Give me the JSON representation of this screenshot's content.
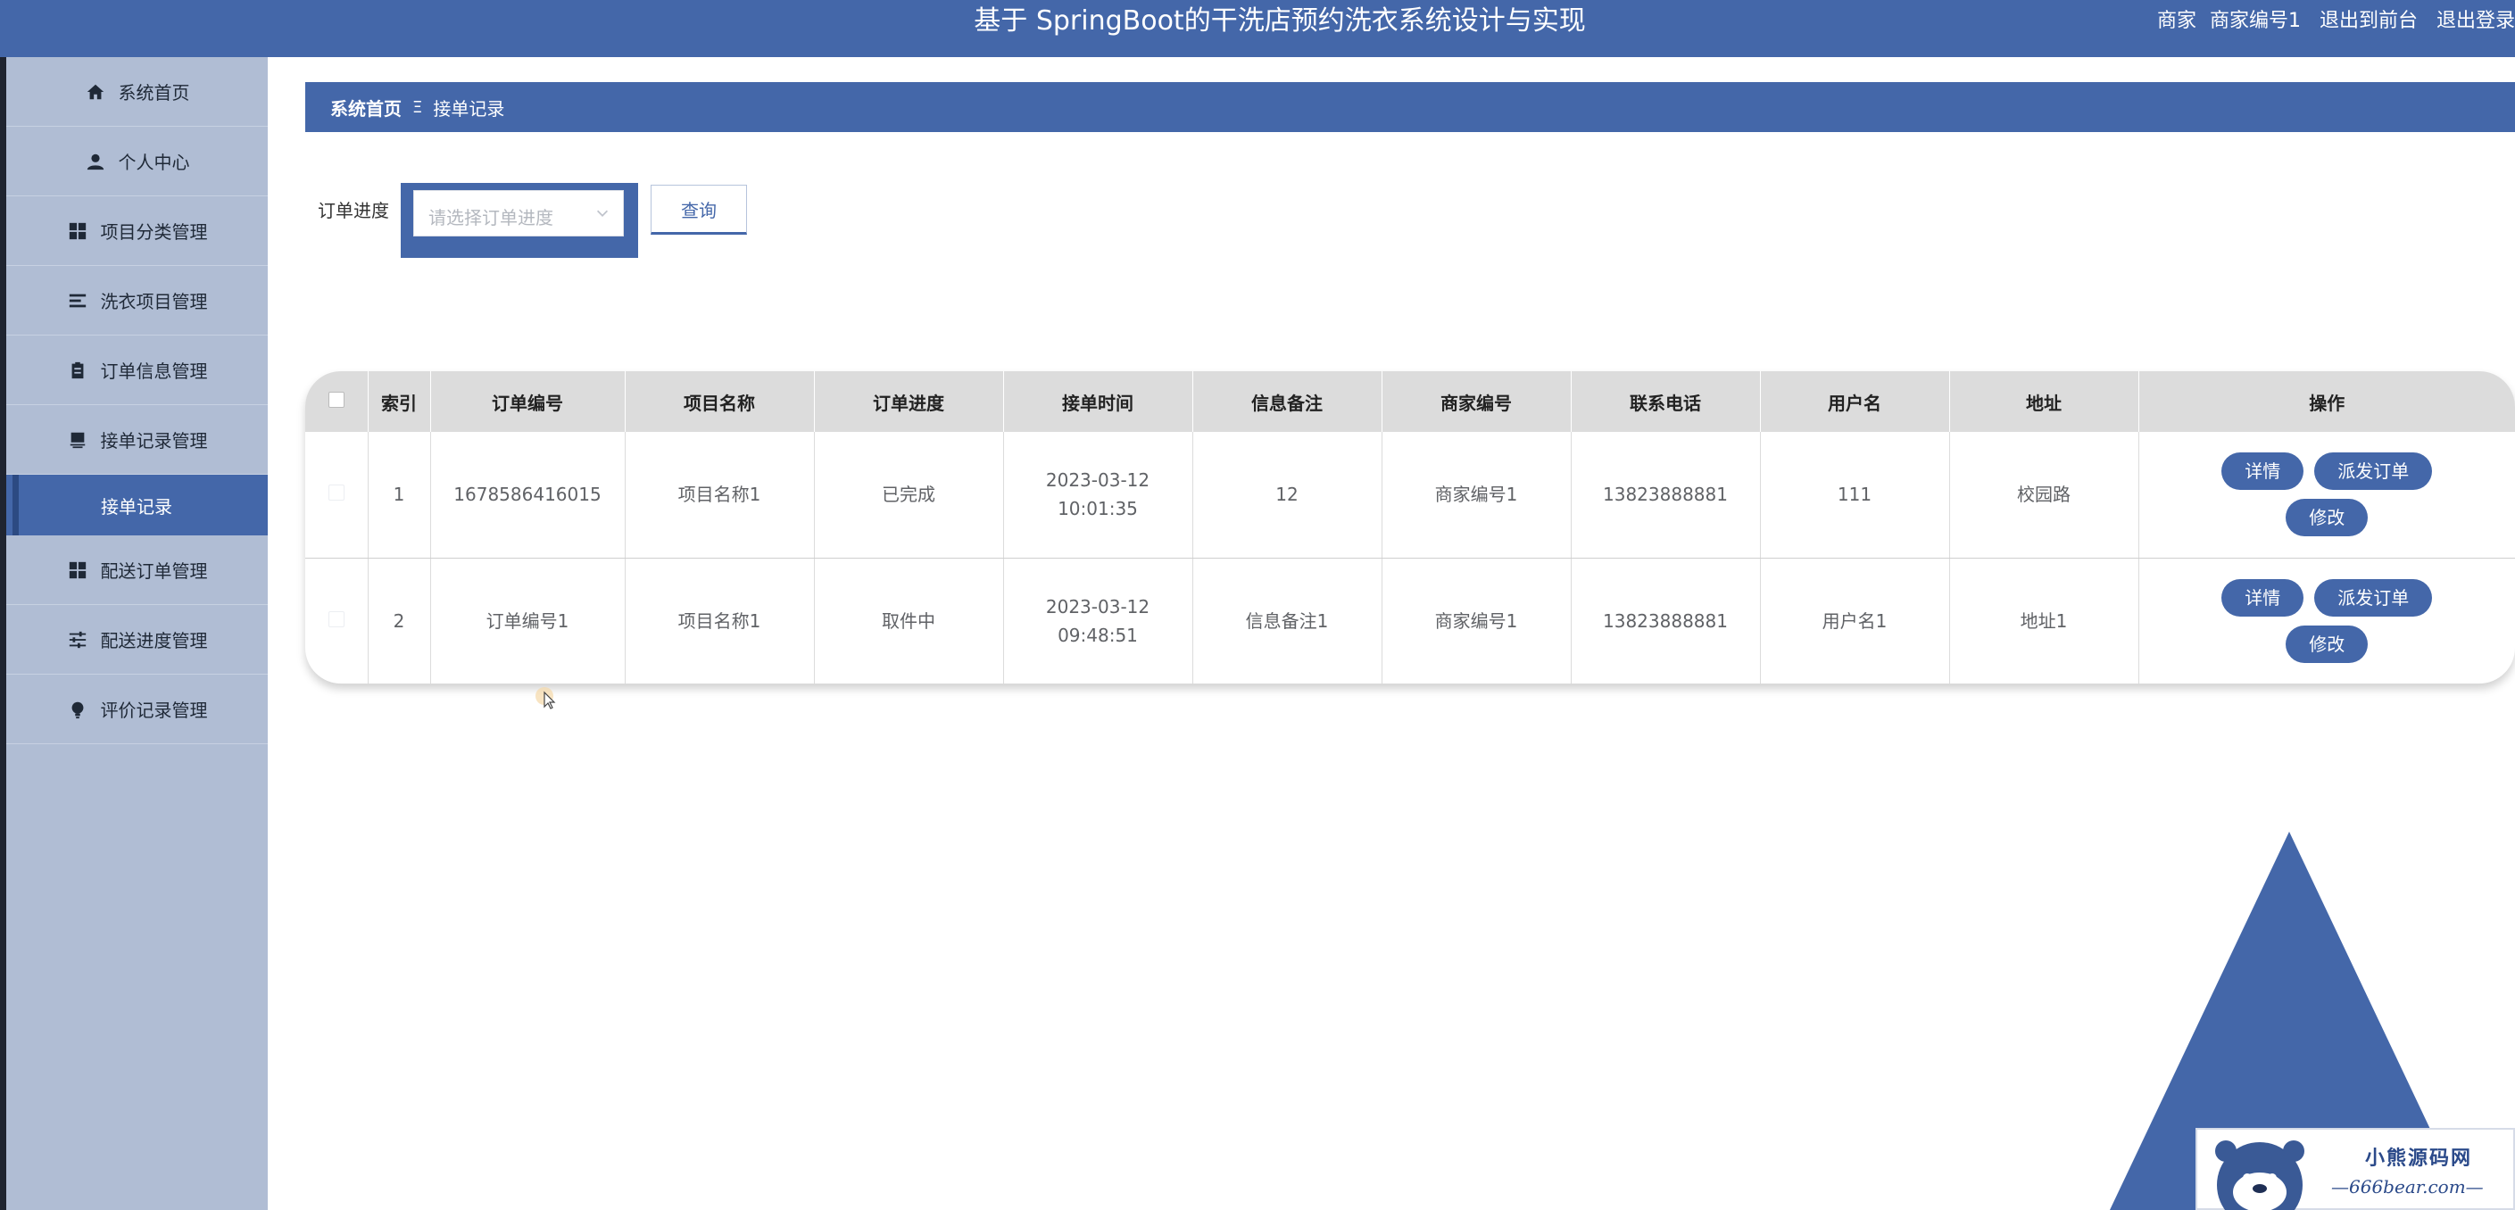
{
  "header": {
    "title": "基于 SpringBoot的干洗店预约洗衣系统设计与实现",
    "role": "商家",
    "username": "商家编号1",
    "to_front": "退出到前台",
    "logout": "退出登录"
  },
  "sidebar": {
    "items": [
      {
        "label": "系统首页",
        "icon": "home-icon"
      },
      {
        "label": "个人中心",
        "icon": "user-icon"
      },
      {
        "label": "项目分类管理",
        "icon": "grid-icon"
      },
      {
        "label": "洗衣项目管理",
        "icon": "list-icon"
      },
      {
        "label": "订单信息管理",
        "icon": "clipboard-icon"
      },
      {
        "label": "接单记录管理",
        "icon": "stamp-icon"
      }
    ],
    "active_sub": "接单记录",
    "items_after": [
      {
        "label": "配送订单管理",
        "icon": "grid-icon"
      },
      {
        "label": "配送进度管理",
        "icon": "sliders-icon"
      },
      {
        "label": "评价记录管理",
        "icon": "bulb-icon"
      }
    ]
  },
  "breadcrumb": {
    "home": "系统首页",
    "separator": "Ξ",
    "current": "接单记录"
  },
  "search": {
    "label": "订单进度",
    "placeholder": "请选择订单进度",
    "query_button": "查询"
  },
  "table": {
    "headers": [
      "索引",
      "订单编号",
      "项目名称",
      "订单进度",
      "接单时间",
      "信息备注",
      "商家编号",
      "联系电话",
      "用户名",
      "地址",
      "操作"
    ],
    "rows": [
      {
        "index": "1",
        "order_no": "1678586416015",
        "item_name": "项目名称1",
        "progress": "已完成",
        "time": "2023-03-12 10:01:35",
        "remark": "12",
        "merchant_no": "商家编号1",
        "phone": "13823888881",
        "username": "111",
        "address": "校园路"
      },
      {
        "index": "2",
        "order_no": "订单编号1",
        "item_name": "项目名称1",
        "progress": "取件中",
        "time": "2023-03-12 09:48:51",
        "remark": "信息备注1",
        "merchant_no": "商家编号1",
        "phone": "13823888881",
        "username": "用户名1",
        "address": "地址1"
      }
    ],
    "actions": {
      "detail": "详情",
      "dispatch": "派发订单",
      "edit": "修改"
    }
  },
  "watermark": {
    "cn": "小熊源码网",
    "en": "—666bear.com—"
  },
  "colors": {
    "primary": "#4467a9",
    "sidebar": "#b0bdd4",
    "table_header": "#dcdcdc"
  }
}
